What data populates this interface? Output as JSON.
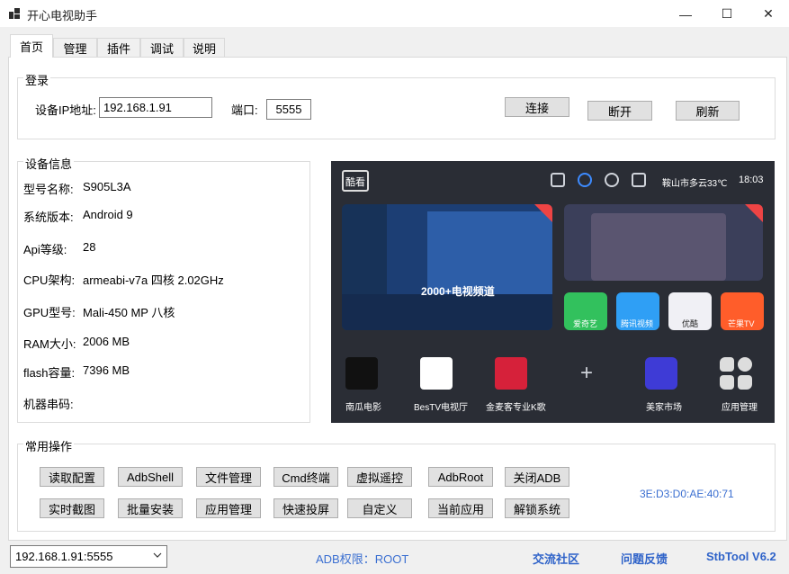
{
  "window": {
    "title": "开心电视助手",
    "min": "—",
    "max": "☐",
    "close": "✕"
  },
  "tabs": [
    "首页",
    "管理",
    "插件",
    "调试",
    "说明"
  ],
  "login": {
    "group_title": "登录",
    "ip_label": "设备IP地址:",
    "ip_value": "192.168.1.91",
    "port_label": "端口:",
    "port_value": "5555",
    "connect_button": "连接",
    "disconnect_button": "断开",
    "refresh_button": "刷新"
  },
  "device_info": {
    "group_title": "设备信息",
    "rows": [
      {
        "label": "型号名称:",
        "value": "S905L3A"
      },
      {
        "label": "系统版本:",
        "value": "Android 9"
      },
      {
        "label": "Api等级:",
        "value": "28"
      },
      {
        "label": "CPU架构:",
        "value": "armeabi-v7a 四核 2.02GHz"
      },
      {
        "label": "GPU型号:",
        "value": "Mali-450 MP 八核"
      },
      {
        "label": "RAM大小:",
        "value": "2006 MB"
      },
      {
        "label": "flash容量:",
        "value": "7396 MB"
      },
      {
        "label": "机器串码:",
        "value": ""
      }
    ]
  },
  "tv_screen": {
    "logo": "酷看",
    "weather": "鞍山市多云33℃",
    "time": "18:03",
    "banner": "2000+电视频道",
    "apps": [
      "南瓜电影",
      "BesTV电视厅",
      "金麦客专业K歌",
      "",
      "美家市场",
      "应用管理"
    ],
    "small_apps": [
      "爱奇艺",
      "腾讯视频",
      "优酷",
      "芒果TV"
    ],
    "brand_colors": {
      "iqiyi": "#32c15d",
      "tencent": "#2f9ff5",
      "youku": "#f0f0f5",
      "mango": "#ff5d2a"
    }
  },
  "common_ops": {
    "group_title": "常用操作",
    "row1": [
      "读取配置",
      "AdbShell",
      "文件管理",
      "Cmd终端",
      "虚拟遥控",
      "AdbRoot",
      "关闭ADB"
    ],
    "row2": [
      "实时截图",
      "批量安装",
      "应用管理",
      "快速投屏",
      "自定义",
      "当前应用",
      "解锁系统"
    ],
    "mac": "3E:D3:D0:AE:40:71"
  },
  "status": {
    "device_select": "192.168.1.91:5555",
    "adb_permission": "ADB权限：ROOT",
    "community": "交流社区",
    "feedback": "问题反馈",
    "version": "StbTool V6.2"
  }
}
